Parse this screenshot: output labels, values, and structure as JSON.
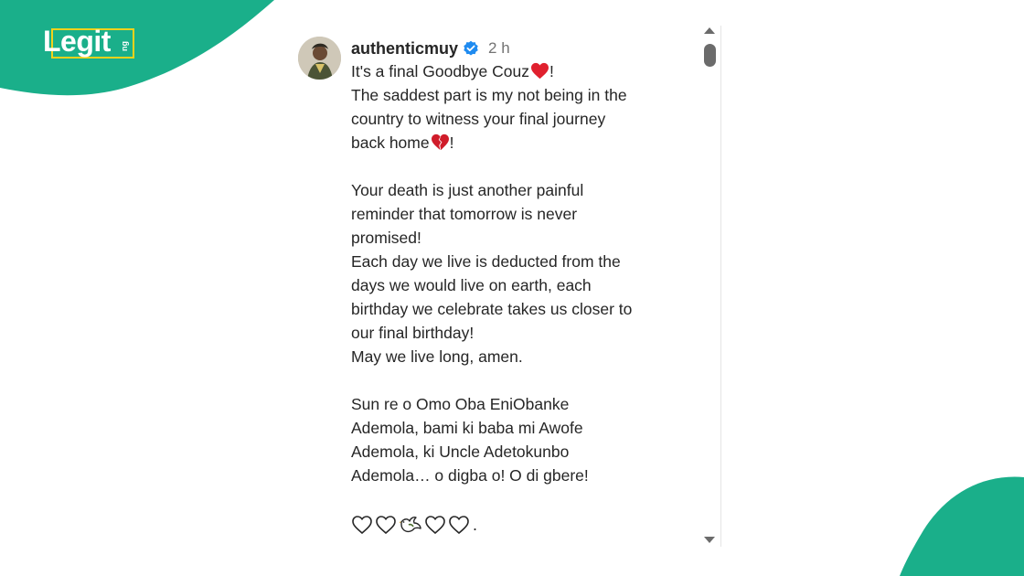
{
  "brand": {
    "logo_text": "Legit",
    "logo_suffix": "ng",
    "green": "#1aaf8a",
    "yellow": "#f2d21b"
  },
  "post": {
    "username": "authenticmuy",
    "verified_icon": "verified-badge-icon",
    "time": "2 h",
    "caption": {
      "line1": "It's a final Goodbye Couz",
      "line1_end": "!",
      "line2": "The saddest part is my not being in the",
      "line3": "country to witness your final journey",
      "line4": "back home",
      "line4_end": "!",
      "line5": "Your death is just another painful",
      "line6": "reminder that tomorrow is never",
      "line7": "promised!",
      "line8": "Each day we live is deducted from the",
      "line9": "days we would live on earth, each",
      "line10": "birthday we celebrate takes us closer to",
      "line11": "our final birthday!",
      "line12": "May we live long, amen.",
      "line13": "Sun re o Omo Oba EniObanke",
      "line14": "Ademola, bami ki baba mi Awofe",
      "line15": "Ademola, ki Uncle Adetokunbo",
      "line16": "Ademola… o digba o! O di gbere!"
    },
    "emoji_end": ".",
    "icons": [
      "red-heart-icon",
      "broken-heart-icon",
      "white-heart-icon",
      "dove-icon"
    ],
    "heart_color": "#e0202e"
  },
  "scrollbar": {
    "up_icon": "scroll-up-arrow-icon",
    "down_icon": "scroll-down-arrow-icon"
  }
}
